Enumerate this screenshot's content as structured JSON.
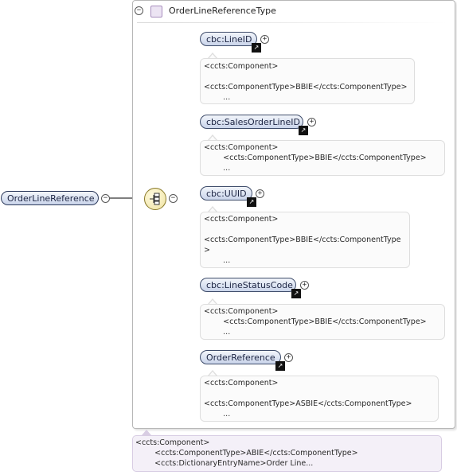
{
  "type_box": {
    "title": "OrderLineReferenceType"
  },
  "root": {
    "label": "OrderLineReference"
  },
  "elements": [
    {
      "label": "cbc:LineID",
      "note": [
        "<ccts:Component>",
        "",
        "<ccts:ComponentType>BBIE</ccts:ComponentType>",
        "        ..."
      ]
    },
    {
      "label": "cbc:SalesOrderLineID",
      "note": [
        "<ccts:Component>",
        "        <ccts:ComponentType>BBIE</ccts:ComponentType>",
        "        ..."
      ]
    },
    {
      "label": "cbc:UUID",
      "note": [
        "<ccts:Component>",
        "",
        "<ccts:ComponentType>BBIE</ccts:ComponentType",
        ">",
        "        ..."
      ]
    },
    {
      "label": "cbc:LineStatusCode",
      "note": [
        "<ccts:Component>",
        "        <ccts:ComponentType>BBIE</ccts:ComponentType>",
        "        ..."
      ]
    },
    {
      "label": "OrderReference",
      "note": [
        "<ccts:Component>",
        "",
        "<ccts:ComponentType>ASBIE</ccts:ComponentType>",
        "        ..."
      ]
    }
  ],
  "root_note": [
    "<ccts:Component>",
    "        <ccts:ComponentType>ABIE</ccts:ComponentType>",
    "        <ccts:DictionaryEntryName>Order Line..."
  ],
  "toggles": {
    "expand": "+",
    "collapse": "−"
  },
  "icons": {
    "link": "external-link-icon",
    "sequence": "sequence-compositor-icon",
    "type": "complex-type-icon"
  },
  "colors": {
    "pill_fill_top": "#f2f5fb",
    "pill_fill_bottom": "#c9d4ea",
    "pill_border": "#3f4d6b",
    "type_swatch": "#ece4f3",
    "root_note_bg": "#f4f0f8",
    "connector": "#333333"
  }
}
